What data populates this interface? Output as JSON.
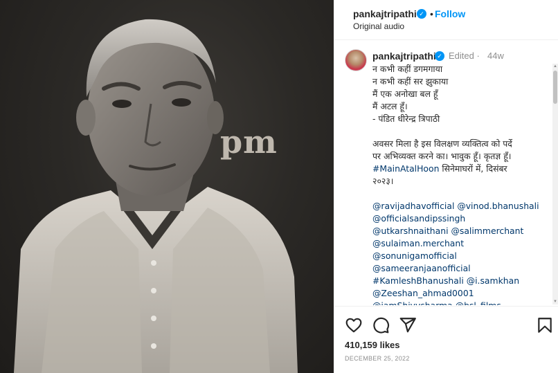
{
  "media": {
    "overlay_word": "pm"
  },
  "header": {
    "username": "pankajtripathi",
    "verified_icon": "verified-badge-icon",
    "separator": "•",
    "follow_label": "Follow",
    "audio_label": "Original audio"
  },
  "comment": {
    "username": "pankajtripathi",
    "verified_icon": "verified-badge-icon",
    "edited": "Edited",
    "separator": "·",
    "time": "44w",
    "lines": [
      "न कभी कहीं डगमगाया",
      "न कभी कहीं सर झुकाया",
      "मैं एक अनोखा बल हूँ",
      "मैं अटल हूँ।",
      "- पंडित धीरेन्द्र त्रिपाठी"
    ],
    "paragraph2_lines": [
      "अवसर मिला है इस विलक्षण व्यक्तित्व को पर्दे",
      "पर अभिव्यक्त करने का। भावुक हूँ। कृतज्ञ हूँ।"
    ],
    "hashtag_line": {
      "tag": "#MainAtalHoon",
      "rest": " सिनेमाघरों में, दिसंबर"
    },
    "year_line": "२०२३।",
    "mention_lines": [
      "@ravijadhavofficial @vinod.bhanushali",
      "@officialsandipssingh",
      "@utkarshnaithani @salimmerchant",
      "@sulaiman.merchant",
      "@sonunigamofficial",
      "@sameeranjaanofficial",
      "#KamleshBhanushali @i.samkhan",
      "@Zeeshan_ahmad0001",
      "@iamShivvsharma @bsl_films"
    ]
  },
  "actions": {
    "like_icon": "heart-icon",
    "comment_icon": "comment-icon",
    "share_icon": "share-icon",
    "save_icon": "bookmark-icon",
    "likes": "410,159 likes",
    "date": "DECEMBER 25, 2022"
  },
  "colors": {
    "accent": "#0095f6",
    "link": "#00376b",
    "muted": "#8e8e8e",
    "text": "#262626"
  }
}
